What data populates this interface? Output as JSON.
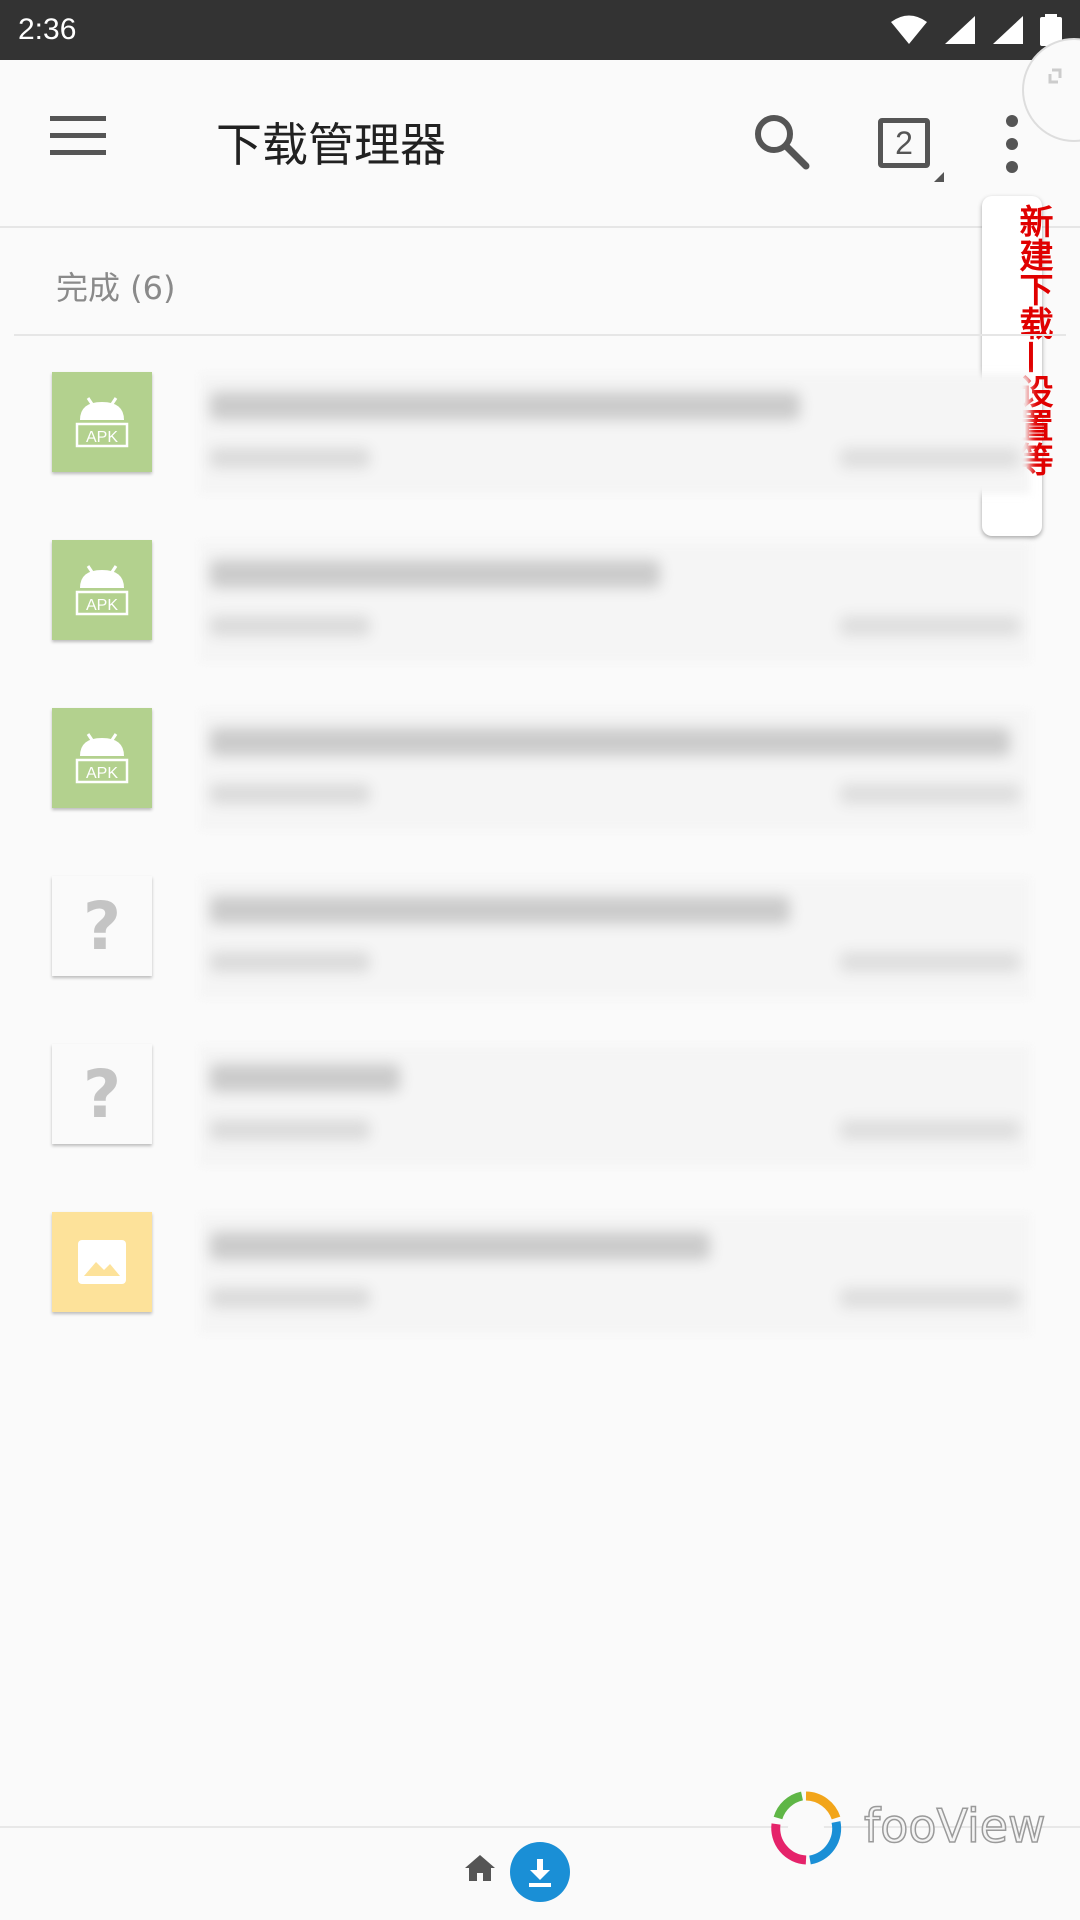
{
  "status_bar": {
    "time": "2:36"
  },
  "app_bar": {
    "title": "下载管理器",
    "tab_count": "2"
  },
  "annotation": {
    "text": "新建下载—设置等"
  },
  "section": {
    "header": "完成 (6)"
  },
  "downloads": [
    {
      "type": "apk",
      "icon": "android-apk-icon",
      "thumb_label": "APK"
    },
    {
      "type": "apk",
      "icon": "android-apk-icon",
      "thumb_label": "APK"
    },
    {
      "type": "apk",
      "icon": "android-apk-icon",
      "thumb_label": "APK"
    },
    {
      "type": "unknown",
      "icon": "question-mark-icon",
      "thumb_label": "?"
    },
    {
      "type": "unknown",
      "icon": "question-mark-icon",
      "thumb_label": "?"
    },
    {
      "type": "image",
      "icon": "image-icon",
      "thumb_label": ""
    }
  ],
  "bottom_bar": {
    "home_icon": "home-icon",
    "download_icon": "download-icon"
  },
  "watermark": {
    "text": "fooView"
  },
  "colors": {
    "status_bar": "#333333",
    "apk_thumb": "#b3d18e",
    "image_thumb": "#fde29a",
    "accent_blue": "#1a8fd6",
    "annotation_red": "#e00000"
  }
}
